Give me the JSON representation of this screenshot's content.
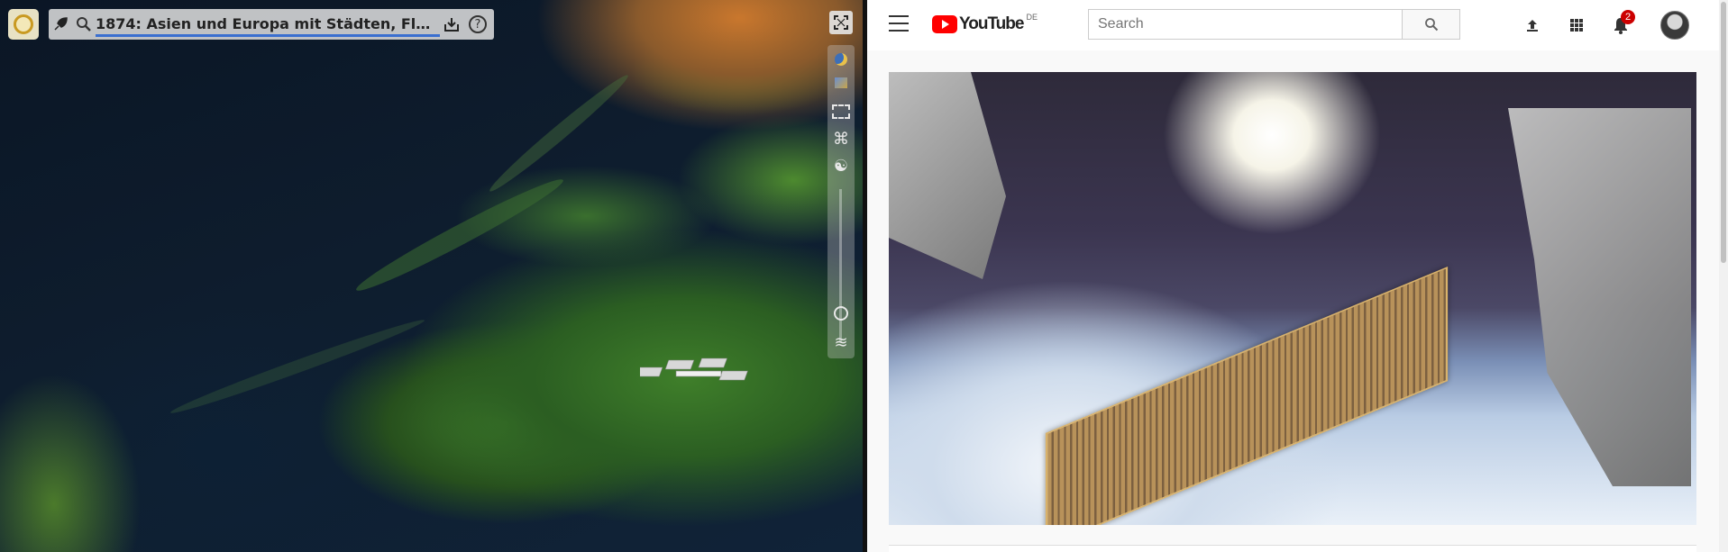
{
  "map_app": {
    "title": "1874: Asien und Europa mit Städten, Flüssen, …",
    "toolbar_icons": [
      "rocket-icon",
      "magnifier-icon",
      "download-icon",
      "help-icon"
    ],
    "help_label": "?",
    "side_tools": [
      "moon-icon",
      "layers-icon",
      "selection-icon",
      "command-icon",
      "yin-yang-icon",
      "circle-icon",
      "wave-icon"
    ]
  },
  "youtube": {
    "logo_text": "YouTube",
    "country_code": "DE",
    "search": {
      "placeholder": "Search",
      "value": ""
    },
    "notifications_count": "2",
    "colors": {
      "brand": "#ff0000",
      "badge": "#cc0000"
    }
  }
}
